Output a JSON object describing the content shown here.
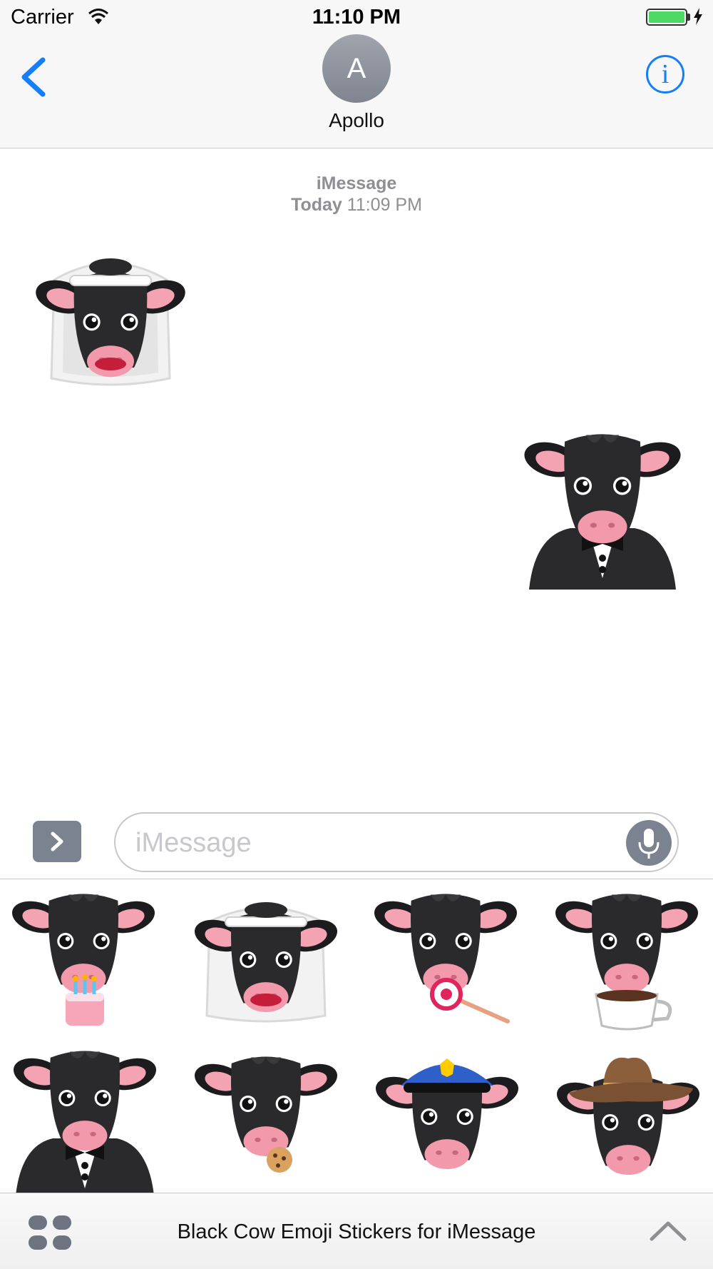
{
  "status_bar": {
    "carrier": "Carrier",
    "time": "11:10 PM",
    "battery_color": "#4cd964"
  },
  "header": {
    "back_icon": "chevron-left-icon",
    "avatar_initial": "A",
    "contact_name": "Apollo",
    "info_icon": "info-icon",
    "accent_color": "#147efb"
  },
  "conversation": {
    "service": "iMessage",
    "timestamp_day": "Today",
    "timestamp_time": "11:09 PM",
    "messages": [
      {
        "sender": "received",
        "sticker": "cow-veil"
      },
      {
        "sender": "sent",
        "sticker": "cow-tuxedo"
      }
    ]
  },
  "input": {
    "placeholder": "iMessage",
    "apps_toggle_icon": "chevron-right-icon",
    "mic_icon": "microphone-icon"
  },
  "drawer": {
    "stickers": [
      "cow-birthday-cake",
      "cow-veil",
      "cow-lollipop",
      "cow-coffee",
      "cow-tuxedo",
      "cow-cookie",
      "cow-police-hat",
      "cow-cowboy-hat"
    ]
  },
  "bottom_bar": {
    "grid_icon": "app-grid-icon",
    "app_title": "Black Cow Emoji Stickers for iMessage",
    "expand_icon": "chevron-up-icon"
  }
}
